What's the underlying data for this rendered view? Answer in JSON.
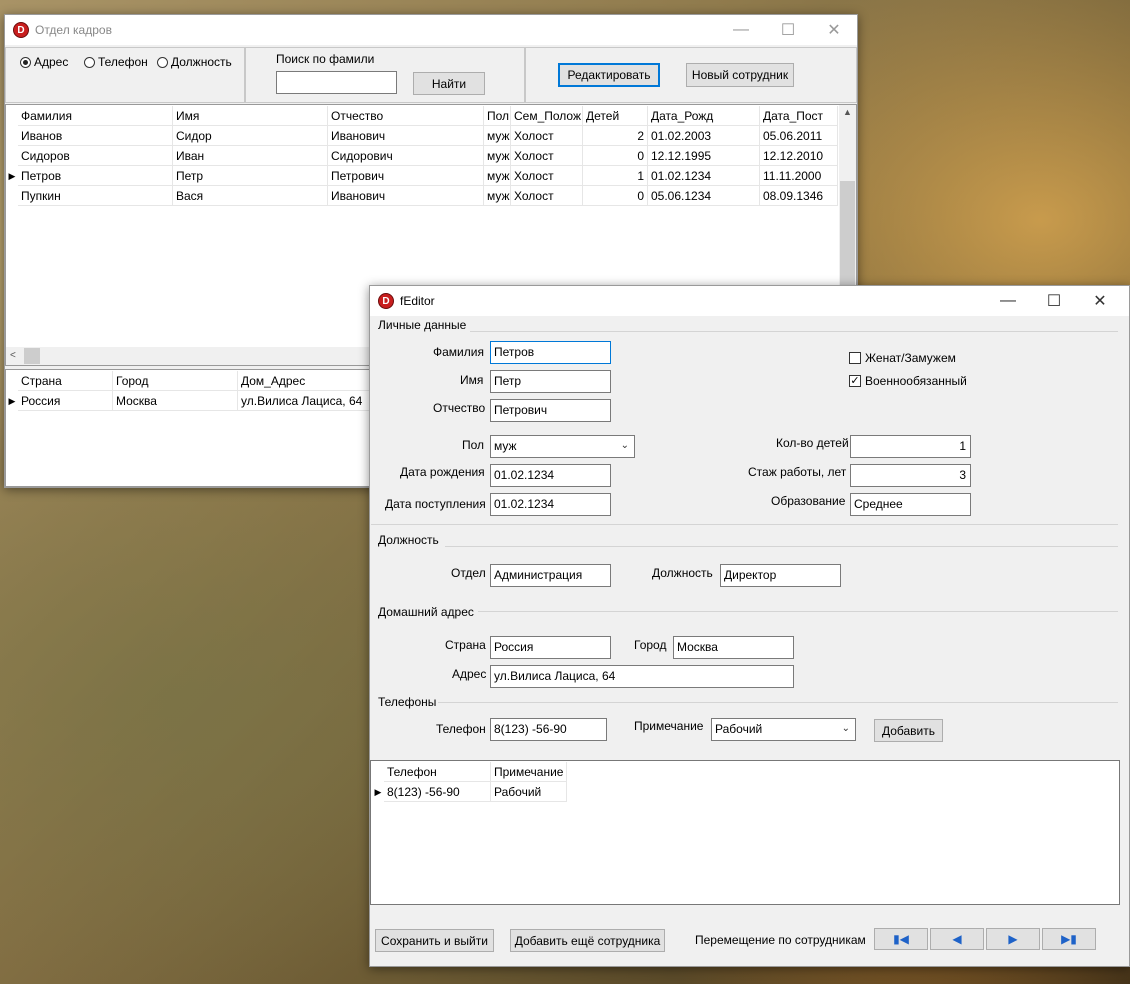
{
  "main_window": {
    "title": "Отдел кадров",
    "filter": {
      "options": [
        "Адрес",
        "Телефон",
        "Должность"
      ],
      "selected": "Адрес"
    },
    "search": {
      "label": "Поиск по фамили",
      "value": "",
      "button": "Найти"
    },
    "edit_button": "Редактировать",
    "new_button": "Новый сотрудник",
    "employees": {
      "columns": [
        "Фамилия",
        "Имя",
        "Отчество",
        "Пол",
        "Сем_Полож",
        "Детей",
        "Дата_Рожд",
        "Дата_Пост"
      ],
      "rows": [
        [
          "Иванов",
          "Сидор",
          "Иванович",
          "муж",
          "Холост",
          "2",
          "01.02.2003",
          "05.06.2011"
        ],
        [
          "Сидоров",
          "Иван",
          "Сидорович",
          "муж",
          "Холост",
          "0",
          "12.12.1995",
          "12.12.2010"
        ],
        [
          "Петров",
          "Петр",
          "Петрович",
          "муж",
          "Холост",
          "1",
          "01.02.1234",
          "11.11.2000"
        ],
        [
          "Пупкин",
          "Вася",
          "Иванович",
          "муж",
          "Холост",
          "0",
          "05.06.1234",
          "08.09.1346"
        ]
      ],
      "current_row": 2
    },
    "address": {
      "columns": [
        "Страна",
        "Город",
        "Дом_Адрес"
      ],
      "rows": [
        [
          "Россия",
          "Москва",
          "ул.Вилиса Лациса, 64"
        ]
      ]
    }
  },
  "editor": {
    "title": "fEditor",
    "personal": {
      "group": "Личные данные",
      "last_name_label": "Фамилия",
      "last_name": "Петров",
      "first_name_label": "Имя",
      "first_name": "Петр",
      "patronymic_label": "Отчество",
      "patronymic": "Петрович",
      "gender_label": "Пол",
      "gender": "муж",
      "birth_label": "Дата рождения",
      "birth": "01.02.1234",
      "hire_label": "Дата поступления",
      "hire": "01.02.1234",
      "married_label": "Женат/Замужем",
      "married": false,
      "military_label": "Военнообязанный",
      "military": true,
      "children_label": "Кол-во детей",
      "children": "1",
      "experience_label": "Стаж работы, лет",
      "experience": "3",
      "education_label": "Образование",
      "education": "Среднее"
    },
    "position": {
      "group": "Должность",
      "dept_label": "Отдел",
      "dept": "Администрация",
      "post_label": "Должность",
      "post": "Директор"
    },
    "home_address": {
      "group": "Домашний адрес",
      "country_label": "Страна",
      "country": "Россия",
      "city_label": "Город",
      "city": "Москва",
      "address_label": "Адрес",
      "address": "ул.Вилиса Лациса, 64"
    },
    "phones": {
      "group": "Телефоны",
      "phone_label": "Телефон",
      "phone": "8(123)   -56-90",
      "note_label": "Примечание",
      "note": "Рабочий",
      "add_button": "Добавить",
      "columns": [
        "Телефон",
        "Примечание"
      ],
      "rows": [
        [
          "8(123)   -56-90",
          "Рабочий"
        ]
      ]
    },
    "save_button": "Сохранить и выйти",
    "add_more_button": "Добавить ещё сотрудника",
    "nav_label": "Перемещение по сотрудникам",
    "nav_buttons": [
      "first-icon",
      "prev-icon",
      "next-icon",
      "last-icon"
    ]
  }
}
